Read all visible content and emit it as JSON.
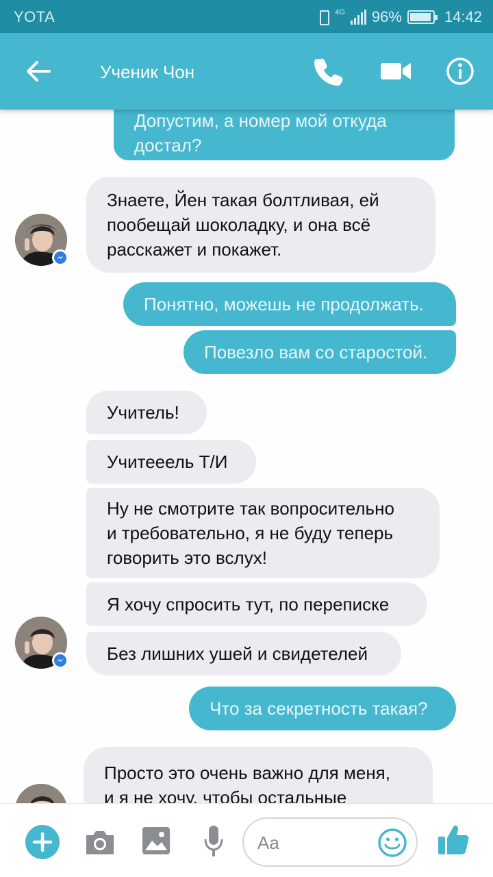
{
  "status_bar": {
    "carrier": "YOTA",
    "network": "4G",
    "battery": "96%",
    "time": "14:42"
  },
  "header": {
    "title": "Ученик Чон",
    "icons": [
      "back-arrow-icon",
      "phone-icon",
      "video-camera-icon",
      "info-icon"
    ]
  },
  "messages": [
    {
      "dir": "out",
      "lines": [
        "Допустим, а номер мой откуда",
        "достал?"
      ]
    },
    {
      "dir": "in",
      "lines": [
        "Знаете, Йен такая болтливая, ей",
        "пообещай шоколадку, и она всё",
        "расскажет и покажет."
      ]
    },
    {
      "dir": "out",
      "lines": [
        "Понятно, можешь не продолжать."
      ]
    },
    {
      "dir": "out",
      "lines": [
        "Повезло вам со старостой."
      ]
    },
    {
      "dir": "in",
      "lines": [
        "Учитель!"
      ]
    },
    {
      "dir": "in",
      "lines": [
        "Учитееель Т/И"
      ]
    },
    {
      "dir": "in",
      "lines": [
        "Ну не смотрите так вопросительно",
        "и требовательно, я не буду теперь",
        "говорить это вслух!"
      ]
    },
    {
      "dir": "in",
      "lines": [
        "Я хочу спросить тут, по переписке"
      ]
    },
    {
      "dir": "in",
      "lines": [
        "Без лишних ушей и свидетелей"
      ]
    },
    {
      "dir": "out",
      "lines": [
        "Что за секретность такая?"
      ]
    },
    {
      "dir": "in",
      "lines": [
        "Просто это очень важно для меня,",
        "и я не хочу, чтобы остальные"
      ]
    }
  ],
  "composer": {
    "placeholder": "Aa",
    "icons": [
      "plus-icon",
      "camera-icon",
      "image-icon",
      "microphone-icon",
      "emoji-icon",
      "thumbs-up-icon"
    ]
  },
  "colors": {
    "status_bar": "#1f8da3",
    "header": "#45b7ce",
    "outgoing_bubble": "#45b7ce",
    "incoming_bubble": "#ececf0"
  }
}
